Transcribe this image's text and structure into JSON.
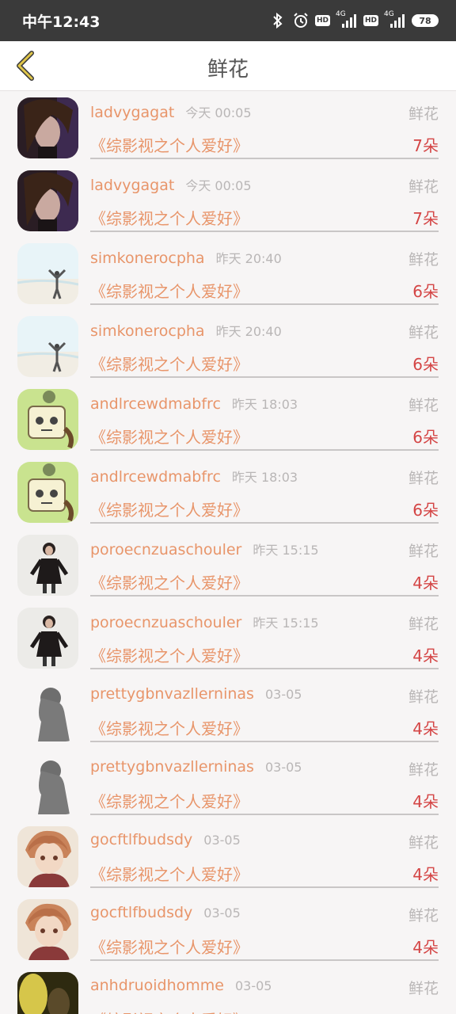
{
  "status": {
    "time": "中午12:43",
    "hd1": "HD",
    "hd2": "HD",
    "net1": "4G",
    "net2": "4G",
    "battery": "78"
  },
  "header": {
    "title": "鲜花"
  },
  "rows": [
    {
      "user": "ladvygagat",
      "time": "今天 00:05",
      "type": "鲜花",
      "book": "《综影视之个人爱好》",
      "count": "7朵",
      "avatar": "dark-hair-man"
    },
    {
      "user": "ladvygagat",
      "time": "今天 00:05",
      "type": "鲜花",
      "book": "《综影视之个人爱好》",
      "count": "7朵",
      "avatar": "dark-hair-man"
    },
    {
      "user": "simkonerocpha",
      "time": "昨天 20:40",
      "type": "鲜花",
      "book": "《综影视之个人爱好》",
      "count": "6朵",
      "avatar": "beach-person"
    },
    {
      "user": "simkonerocpha",
      "time": "昨天 20:40",
      "type": "鲜花",
      "book": "《综影视之个人爱好》",
      "count": "6朵",
      "avatar": "beach-person"
    },
    {
      "user": "andlrcewdmabfrc",
      "time": "昨天 18:03",
      "type": "鲜花",
      "book": "《综影视之个人爱好》",
      "count": "6朵",
      "avatar": "cartoon-robot"
    },
    {
      "user": "andlrcewdmabfrc",
      "time": "昨天 18:03",
      "type": "鲜花",
      "book": "《综影视之个人爱好》",
      "count": "6朵",
      "avatar": "cartoon-robot"
    },
    {
      "user": "poroecnzuaschouler",
      "time": "昨天 15:15",
      "type": "鲜花",
      "book": "《综影视之个人爱好》",
      "count": "4朵",
      "avatar": "girl-black-dress"
    },
    {
      "user": "poroecnzuaschouler",
      "time": "昨天 15:15",
      "type": "鲜花",
      "book": "《综影视之个人爱好》",
      "count": "4朵",
      "avatar": "girl-black-dress"
    },
    {
      "user": "prettygbnvazllerninas",
      "time": "03-05",
      "type": "鲜花",
      "book": "《综影视之个人爱好》",
      "count": "4朵",
      "avatar": "grey-silhouette"
    },
    {
      "user": "prettygbnvazllerninas",
      "time": "03-05",
      "type": "鲜花",
      "book": "《综影视之个人爱好》",
      "count": "4朵",
      "avatar": "grey-silhouette"
    },
    {
      "user": "gocftlfbudsdy",
      "time": "03-05",
      "type": "鲜花",
      "book": "《综影视之个人爱好》",
      "count": "4朵",
      "avatar": "anime-boy"
    },
    {
      "user": "gocftlfbudsdy",
      "time": "03-05",
      "type": "鲜花",
      "book": "《综影视之个人爱好》",
      "count": "4朵",
      "avatar": "anime-boy"
    },
    {
      "user": "anhdruoidhomme",
      "time": "03-05",
      "type": "鲜花",
      "book": "《综影视之个人爱好》",
      "count": "",
      "avatar": "dark-yellow"
    }
  ]
}
